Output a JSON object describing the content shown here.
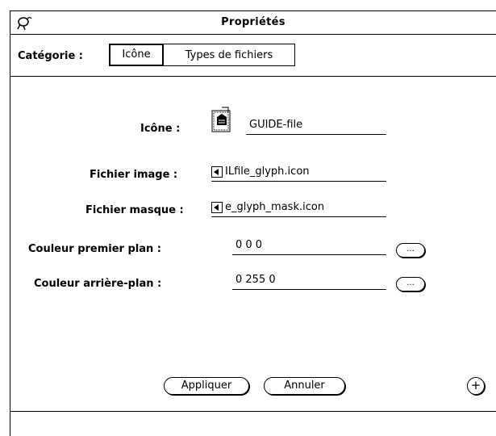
{
  "window": {
    "title": "Propriétés",
    "menu_icon": "glyph-window-menu-icon"
  },
  "category": {
    "label": "Catégorie :",
    "options": [
      "Icône",
      "Types de fichiers"
    ],
    "selected": "Icône"
  },
  "form": {
    "icon_label": "Icône :",
    "icon_name": "GUIDE-file",
    "icon_glyph": "file-glyph-icon",
    "image_file_label": "Fichier image :",
    "image_file_value": "ILfile_glyph.icon",
    "mask_file_label": "Fichier masque :",
    "mask_file_value": "e_glyph_mask.icon",
    "fg_color_label": "Couleur premier plan :",
    "fg_color_value": "0 0 0",
    "bg_color_label": "Couleur arrière-plan :",
    "bg_color_value": "0 255 0",
    "chooser_label": "..."
  },
  "buttons": {
    "apply": "Appliquer",
    "cancel": "Annuler",
    "plus": "+"
  }
}
